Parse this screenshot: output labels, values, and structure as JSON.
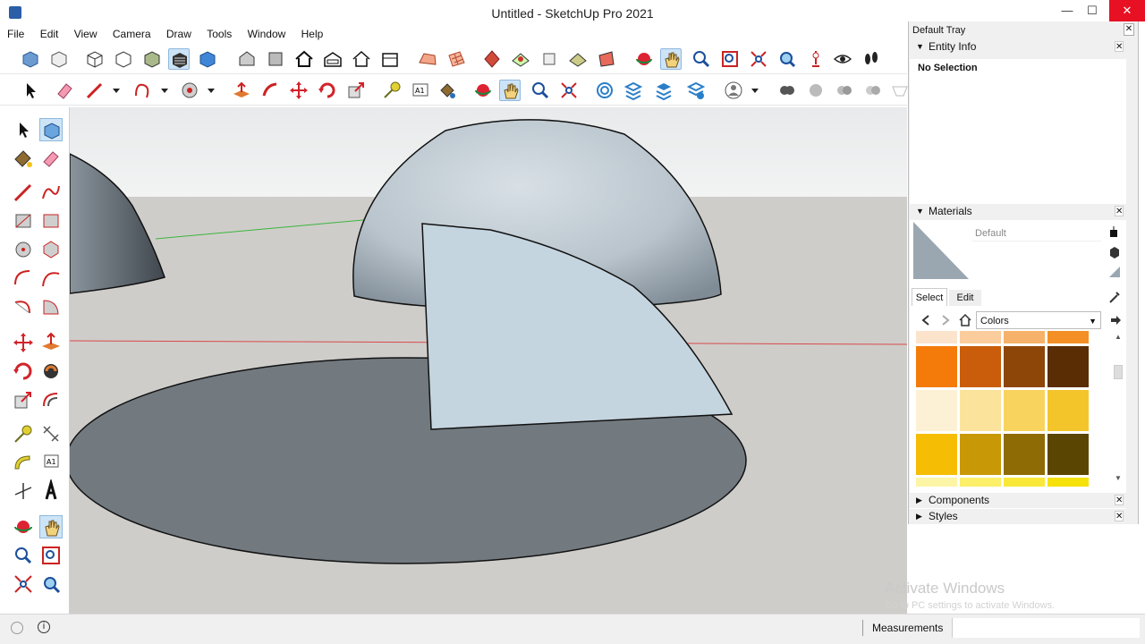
{
  "window": {
    "title": "Untitled - SketchUp Pro 2021",
    "minimize": "—",
    "maximize": "☐",
    "close": "✕"
  },
  "menu": [
    "File",
    "Edit",
    "View",
    "Camera",
    "Draw",
    "Tools",
    "Window",
    "Help"
  ],
  "tray": {
    "title": "Default Tray",
    "entity_info": {
      "title": "Entity Info",
      "selection": "No Selection"
    },
    "materials": {
      "title": "Materials",
      "name": "Default",
      "tabs": [
        "Select",
        "Edit"
      ],
      "library": "Colors",
      "swatches": [
        "#fbe3cc",
        "#fbcc9c",
        "#f6b26a",
        "#f38f24",
        "#f47b0a",
        "#c95d0b",
        "#8e4608",
        "#5b2d04",
        "#fdf1d5",
        "#fce39b",
        "#f8d45e",
        "#f4c52a",
        "#f6bd05",
        "#c99807",
        "#8e6b05",
        "#5b4503",
        "#fdf5a6",
        "#fcef6a",
        "#f9e83a",
        "#f6e10a"
      ]
    },
    "components": "Components",
    "styles": "Styles"
  },
  "status": {
    "measurements_label": "Measurements",
    "measurements_value": ""
  },
  "watermark": {
    "line1": "Activate Windows",
    "line2": "Go to PC settings to activate Windows."
  }
}
